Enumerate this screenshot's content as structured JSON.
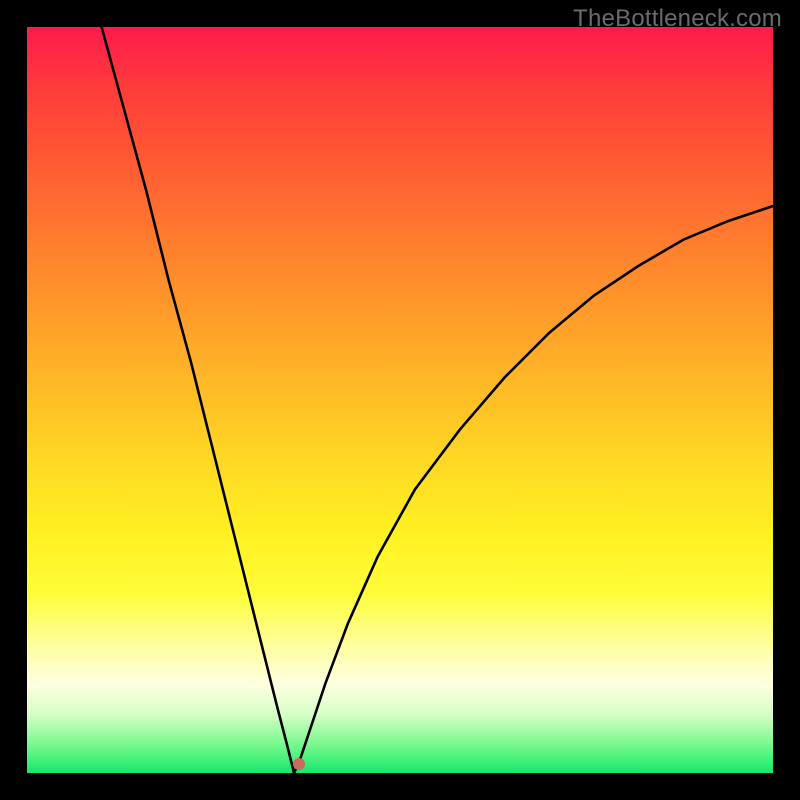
{
  "attribution": "TheBottleneck.com",
  "chart_data": {
    "type": "line",
    "title": "",
    "xlabel": "",
    "ylabel": "",
    "xlim": [
      0,
      100
    ],
    "ylim": [
      0,
      100
    ],
    "grid": false,
    "legend": false,
    "annotations": [],
    "background_gradient": {
      "orientation": "vertical",
      "stops": [
        {
          "pos": 0.0,
          "color": "#ff1a4d"
        },
        {
          "pos": 0.5,
          "color": "#ffb927"
        },
        {
          "pos": 0.7,
          "color": "#fff122"
        },
        {
          "pos": 0.9,
          "color": "#ffffe0"
        },
        {
          "pos": 1.0,
          "color": "#17e86b"
        }
      ]
    },
    "cusp_point": {
      "x": 35.8,
      "y": 0.0
    },
    "marker": {
      "x": 36.5,
      "y": 1.2,
      "color": "#c76a5f"
    },
    "series": [
      {
        "name": "left-branch",
        "x": [
          10,
          13,
          16,
          19,
          22,
          25,
          28,
          30,
          32,
          33.5,
          34.8,
          35.5,
          35.8
        ],
        "values": [
          100,
          89,
          78,
          66,
          55,
          43,
          31,
          23,
          15,
          9,
          4,
          1.2,
          0.0
        ]
      },
      {
        "name": "right-branch",
        "x": [
          35.8,
          36.5,
          38,
          40,
          43,
          47,
          52,
          58,
          64,
          70,
          76,
          82,
          88,
          94,
          100
        ],
        "values": [
          0.0,
          1.5,
          6,
          12,
          20,
          29,
          38,
          46,
          53,
          59,
          64,
          68,
          71.5,
          74,
          76
        ]
      }
    ]
  }
}
